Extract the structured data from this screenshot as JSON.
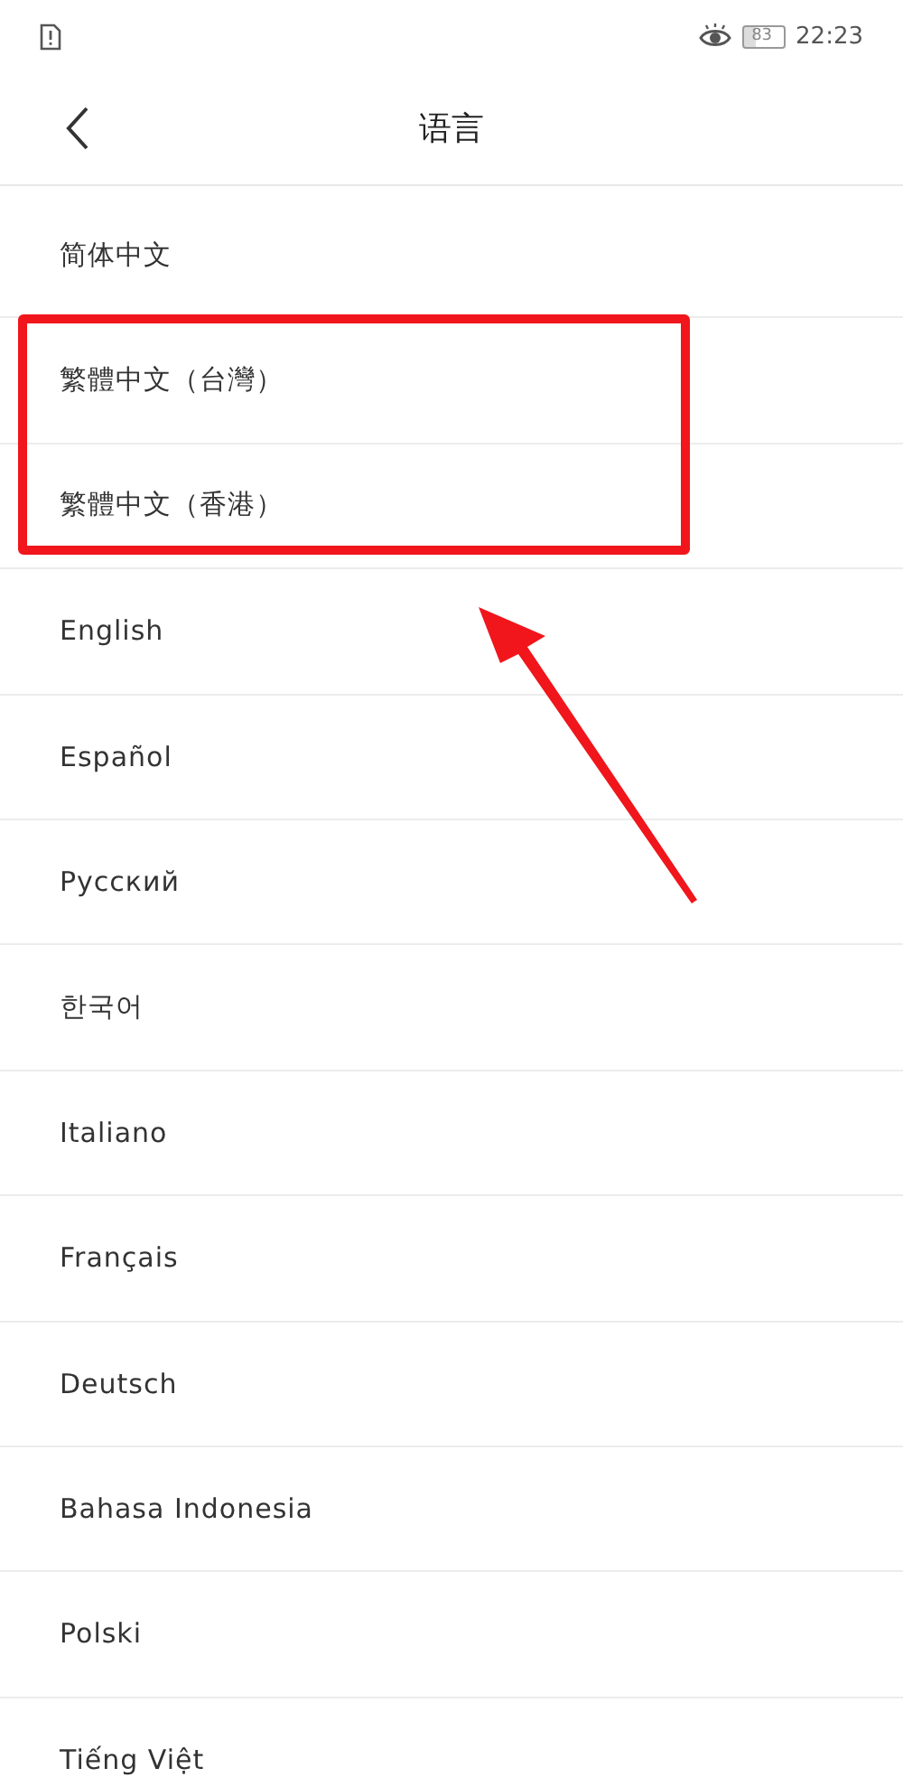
{
  "status_bar": {
    "battery": "83",
    "time": "22:23"
  },
  "header": {
    "title": "语言"
  },
  "languages": [
    {
      "label": "简体中文",
      "highlighted": false
    },
    {
      "label": "繁體中文（台灣）",
      "highlighted": true
    },
    {
      "label": "繁體中文（香港）",
      "highlighted": true
    },
    {
      "label": "English",
      "highlighted": false
    },
    {
      "label": "Español",
      "highlighted": false
    },
    {
      "label": "Русский",
      "highlighted": false
    },
    {
      "label": "한국어",
      "highlighted": false
    },
    {
      "label": "Italiano",
      "highlighted": false
    },
    {
      "label": "Français",
      "highlighted": false
    },
    {
      "label": "Deutsch",
      "highlighted": false
    },
    {
      "label": "Bahasa Indonesia",
      "highlighted": false
    },
    {
      "label": "Polski",
      "highlighted": false
    },
    {
      "label": "Tiếng Việt",
      "highlighted": false
    }
  ]
}
